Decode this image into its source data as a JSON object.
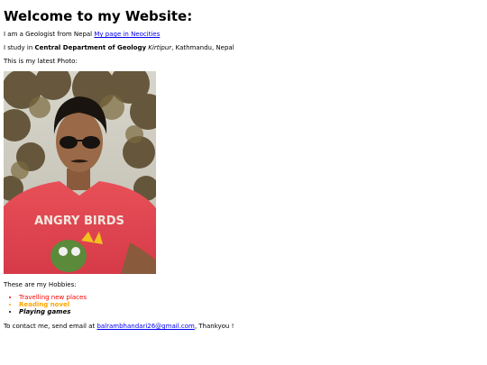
{
  "header": {
    "title": "Welcome to my Website:"
  },
  "intro": {
    "text": "I am a Geologist from Nepal",
    "link_label": "My page in Neocities"
  },
  "study": {
    "prefix": "I study in",
    "department": "Central Department of Geology",
    "place": "Kirtipur",
    "suffix": ", Kathmandu, Nepal"
  },
  "photo": {
    "caption": "This is my latest Photo:",
    "shirt_text": "ANGRY BIRDS"
  },
  "hobbies": {
    "heading": "These are my Hobbies:",
    "items": [
      "Travelling new places",
      "Reading novel",
      "Playing games"
    ]
  },
  "contact": {
    "prefix": "To contact me, send email at",
    "email": "balrambhandari26@gmail.com",
    "suffix": ", Thankyou !"
  },
  "colors": {
    "link": "#0000ee",
    "hobby_1": "#ff0000",
    "hobby_2": "#ffa500",
    "hobby_3": "#000000"
  }
}
